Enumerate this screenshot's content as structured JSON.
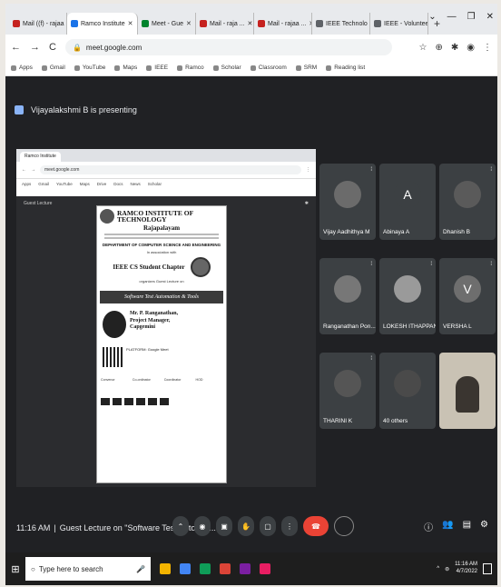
{
  "browser": {
    "tabs": [
      {
        "label": "Mail ((f) - rajaa",
        "color": "#c5221f",
        "active": false
      },
      {
        "label": "Ramco Institute",
        "color": "#1a73e8",
        "active": true
      },
      {
        "label": "Meet - Gue",
        "color": "#00832d",
        "active": false
      },
      {
        "label": "Mail - raja ...",
        "color": "#c5221f",
        "active": false
      },
      {
        "label": "Mail - rajaa ...",
        "color": "#c5221f",
        "active": false
      },
      {
        "label": "IEEE Technolo",
        "color": "#5f6368",
        "active": false
      },
      {
        "label": "IEEE - Volunteer",
        "color": "#5f6368",
        "active": false
      }
    ],
    "new_tab_label": "+",
    "window_controls": [
      "⌄",
      "—",
      "❐",
      "✕"
    ],
    "url": "meet.google.com",
    "toolbar_icons": [
      "☆",
      "⊕",
      "✱",
      "◉",
      "⋮"
    ],
    "bookmarks": [
      "Apps",
      "Gmail",
      "YouTube",
      "Maps",
      "IEEE",
      "Ramco",
      "Scholar",
      "Classroom",
      "SRM",
      "Reading list"
    ]
  },
  "meet": {
    "presenting_text": "Vijayalakshmi B is presenting",
    "presentation": {
      "inner_tab": "Ramco Institute",
      "inner_url": "meet.google.com",
      "inner_bookmarks": [
        "Apps",
        "Gmail",
        "YouTube",
        "Maps",
        "Drive",
        "Docs",
        "News",
        "Scholar"
      ],
      "meeting_title": "Guest Lecture",
      "poster": {
        "college": "RAMCO INSTITUTE OF TECHNOLOGY",
        "place": "Rajapalayam",
        "department": "DEPARTMENT OF COMPUTER SCIENCE AND ENGINEERING",
        "association": "In association with",
        "chapter": "IEEE CS Student Chapter",
        "organise": "organizes Guest Lecture on",
        "topic": "Software Test Automation & Tools",
        "speaker_name": "Mr. P. Ranganathan,",
        "speaker_role": "Project Manager,",
        "speaker_company": "Capgemini",
        "platform": "PLATFORM: Google Meet",
        "coordinators": [
          "Convenor",
          "Co-ordinator",
          "Coordinator",
          "HOD"
        ]
      }
    },
    "participants": [
      {
        "name": "Vijay Aadhithya M",
        "initial": "",
        "bg": "#6b6b6b",
        "mic": "⁞"
      },
      {
        "name": "Abinaya A",
        "initial": "A",
        "bg": "#3c4043",
        "mic": ""
      },
      {
        "name": "Dhanish B",
        "initial": "",
        "bg": "#5a5a5a",
        "mic": "⁞"
      },
      {
        "name": "Ranganathan Pon...",
        "initial": "",
        "bg": "#777",
        "mic": "⁞"
      },
      {
        "name": "LOKESH ITHAPPAN",
        "initial": "",
        "bg": "#9a9a9a",
        "mic": "⁞"
      },
      {
        "name": "VERSHA L",
        "initial": "V",
        "bg": "#6e6e6e",
        "mic": "⁞"
      },
      {
        "name": "THARINI K",
        "initial": "",
        "bg": "#555",
        "mic": "⁞"
      },
      {
        "name": "40 others",
        "initial": "",
        "bg": "#4a4a4a",
        "mic": ""
      },
      {
        "name": "",
        "initial": "",
        "bg": "#8a8a8a",
        "mic": ""
      }
    ],
    "bottom": {
      "time": "11:16 AM",
      "separator": "|",
      "title": "Guest Lecture on \"Software Test Automat..."
    },
    "controls": [
      "⌃",
      "◉",
      "▣",
      "✋",
      "▢",
      "⋮"
    ],
    "right_controls": [
      "ⓘ",
      "👥",
      "▤",
      "⚙"
    ]
  },
  "taskbar": {
    "start_icon": "⊞",
    "search_placeholder": "Type here to search",
    "icons": [
      "#f4b400",
      "#4285f4",
      "#0f9d58",
      "#db4437",
      "#7b1fa2",
      "#e91e63"
    ],
    "time": "11:16 AM",
    "date": "4/7/2022"
  }
}
